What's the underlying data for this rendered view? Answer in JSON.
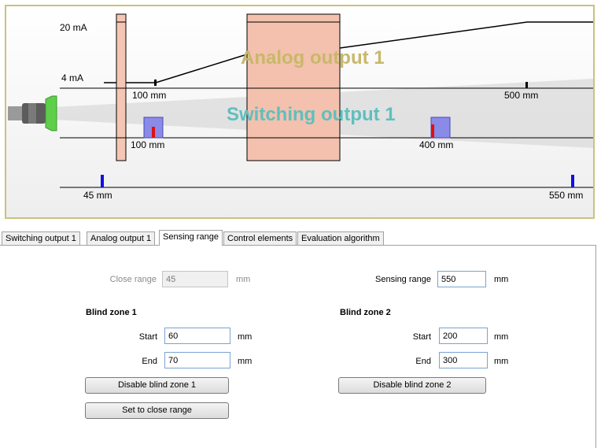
{
  "diagram": {
    "current_high": "20 mA",
    "current_low": "4 mA",
    "analog_title": "Analog output 1",
    "switching_title": "Switching output 1",
    "analog_start": "100 mm",
    "analog_end": "500 mm",
    "switch_start": "100 mm",
    "switch_end": "400 mm",
    "range_start": "45 mm",
    "range_end": "550 mm",
    "colors": {
      "analog_title": "#c8b86a",
      "switching_title": "#5fbfbf",
      "blind_zone": "#f5c6b4",
      "switch_marker": "#8a8ae8",
      "marker_red": "#e01010",
      "range_marker": "#1010e0"
    }
  },
  "tabs": [
    {
      "label": "Switching output 1"
    },
    {
      "label": "Analog output 1"
    },
    {
      "label": "Sensing range"
    },
    {
      "label": "Control elements"
    },
    {
      "label": "Evaluation algorithm"
    }
  ],
  "form": {
    "close_range_label": "Close range",
    "close_range_value": "45",
    "sensing_range_label": "Sensing range",
    "sensing_range_value": "550",
    "unit": "mm",
    "bz1_title": "Blind zone 1",
    "bz2_title": "Blind zone 2",
    "start_label": "Start",
    "end_label": "End",
    "bz1_start": "60",
    "bz1_end": "70",
    "bz2_start": "200",
    "bz2_end": "300",
    "disable_bz1": "Disable blind zone 1",
    "disable_bz2": "Disable blind zone 2",
    "set_close_range": "Set to close range"
  }
}
